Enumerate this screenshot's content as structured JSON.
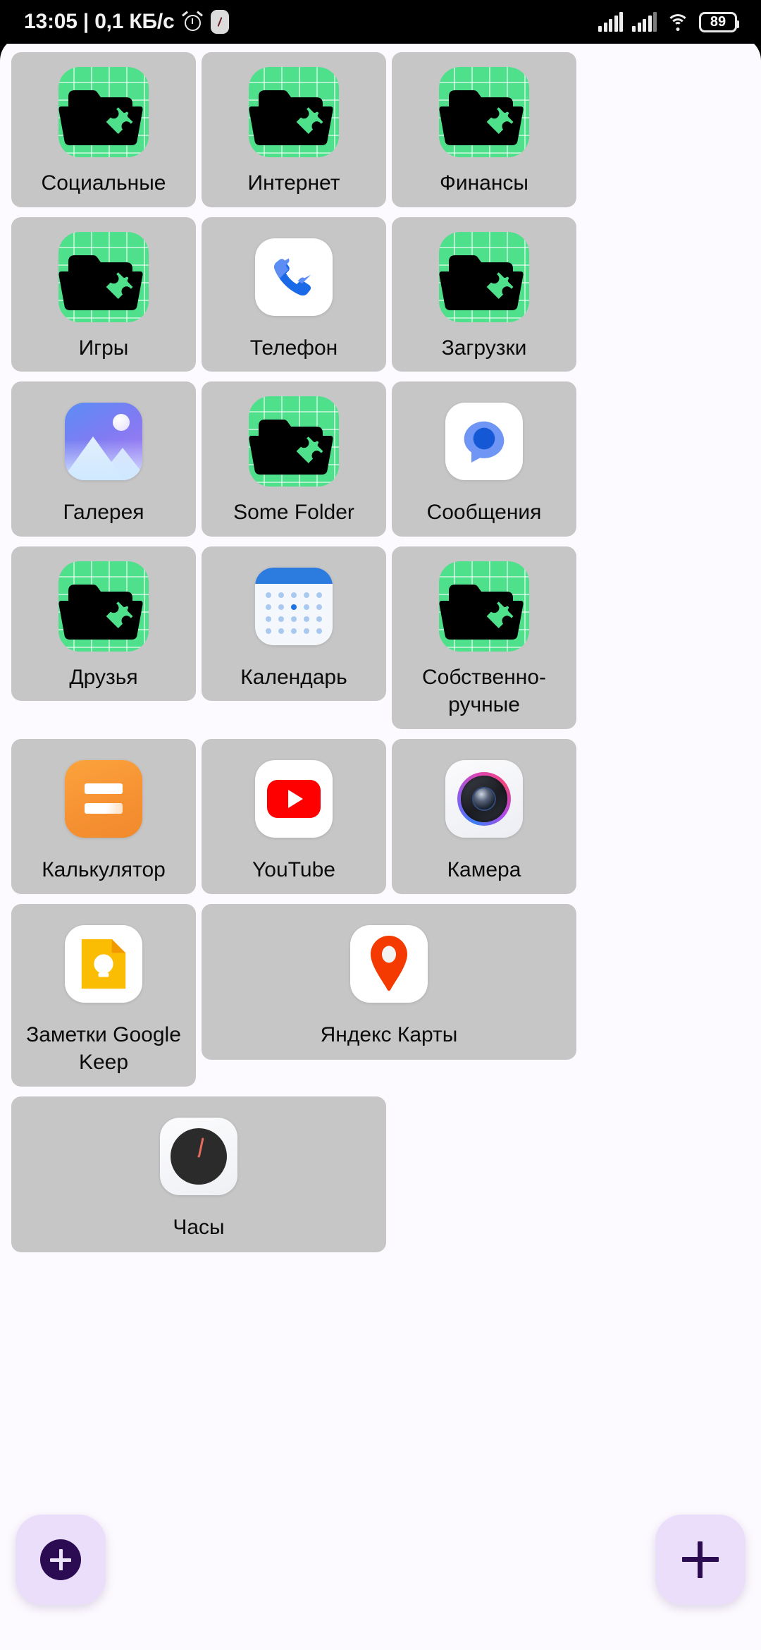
{
  "status_bar": {
    "clock_and_traffic": "13:05 | 0,1 КБ/с",
    "alarm_icon": "alarm-clock-icon",
    "clock_app_icon": "clock-app-icon",
    "signal_1_icon": "cellular-signal-icon",
    "signal_2_icon": "cellular-signal-icon",
    "wifi_icon": "wifi-icon",
    "battery_percent": "89",
    "background_color": "#000000"
  },
  "theme": {
    "sheet_background": "#fdfaff",
    "tile_background": "#c6c6c6",
    "label_color": "#0b0b0b",
    "folder_accent": "#4ee08b",
    "fab_background": "#ebdefb",
    "fab_accent": "#2b0b52"
  },
  "apps": [
    {
      "label": "Социальные",
      "icon": "folder-puzzle-icon",
      "wide": false
    },
    {
      "label": "Интернет",
      "icon": "folder-puzzle-icon",
      "wide": false
    },
    {
      "label": "Финансы",
      "icon": "folder-puzzle-icon",
      "wide": false
    },
    {
      "label": "Игры",
      "icon": "folder-puzzle-icon",
      "wide": false
    },
    {
      "label": "Телефон",
      "icon": "phone-icon",
      "wide": false
    },
    {
      "label": "Загрузки",
      "icon": "folder-puzzle-icon",
      "wide": false
    },
    {
      "label": "Галерея",
      "icon": "gallery-icon",
      "wide": false
    },
    {
      "label": "Some Folder",
      "icon": "folder-puzzle-icon",
      "wide": false
    },
    {
      "label": "Сообщения",
      "icon": "messages-icon",
      "wide": false
    },
    {
      "label": "Друзья",
      "icon": "folder-puzzle-icon",
      "wide": false
    },
    {
      "label": "Календарь",
      "icon": "calendar-icon",
      "wide": false
    },
    {
      "label": "Собственно-ручные",
      "icon": "folder-puzzle-icon",
      "wide": false
    },
    {
      "label": "Калькулятор",
      "icon": "calculator-icon",
      "wide": false
    },
    {
      "label": "YouTube",
      "icon": "youtube-icon",
      "wide": false
    },
    {
      "label": "Камера",
      "icon": "camera-icon",
      "wide": false
    },
    {
      "label": "Заметки Google Keep",
      "icon": "google-keep-icon",
      "wide": false
    },
    {
      "label": "Яндекс Карты",
      "icon": "yandex-maps-icon",
      "wide": true
    },
    {
      "label": "Часы",
      "icon": "clock-icon",
      "wide": true
    }
  ],
  "fab_left": {
    "icon": "add-circle-icon",
    "glyph": "+"
  },
  "fab_right": {
    "icon": "add-icon",
    "glyph": "+"
  }
}
